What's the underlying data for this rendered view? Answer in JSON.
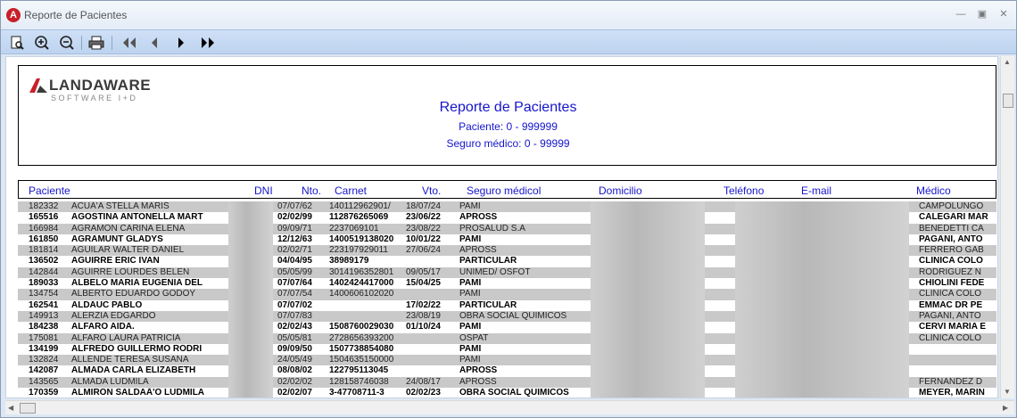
{
  "window": {
    "title": "Reporte de Pacientes"
  },
  "toolbar": {
    "buttons": [
      "preview-icon",
      "zoom-in-icon",
      "zoom-out-icon",
      "print-icon",
      "first-page-icon",
      "prev-page-icon",
      "next-page-icon",
      "last-page-icon"
    ]
  },
  "report": {
    "logo_name": "LANDAWARE",
    "logo_sub": "SOFTWARE I+D",
    "title": "Reporte de Pacientes",
    "subtitle_patient": "Paciente: 0 - 999999",
    "subtitle_insurance": "Seguro médico: 0 - 99999",
    "columns": {
      "paciente": "Paciente",
      "dni": "DNI",
      "nto": "Nto.",
      "carnet": "Carnet",
      "vto": "Vto.",
      "seguro": "Seguro médicol",
      "domicilio": "Domicilio",
      "telefono": "Teléfono",
      "email": "E-mail",
      "medico": "Médico"
    },
    "rows": [
      {
        "id": "182332",
        "name": "ACUÃ'A STELLA MARIS",
        "nto": "07/07/62",
        "carnet": "140112962901/",
        "vto": "18/07/24",
        "seguro": "PAMI",
        "medico": "CAMPOLUNGO"
      },
      {
        "id": "165516",
        "name": "AGOSTINA ANTONELLA MART",
        "nto": "02/02/99",
        "carnet": "112876265069",
        "vto": "23/06/22",
        "seguro": "APROSS",
        "medico": "CALEGARI MAR"
      },
      {
        "id": "166984",
        "name": "AGRAMON CARINA ELENA",
        "nto": "09/09/71",
        "carnet": "2237069101",
        "vto": "23/08/22",
        "seguro": "PROSALUD S.A",
        "medico": "BENEDETTI CA"
      },
      {
        "id": "161850",
        "name": "AGRAMUNT GLADYS",
        "nto": "12/12/63",
        "carnet": "1400519138020",
        "vto": "10/01/22",
        "seguro": "PAMI",
        "medico": "PAGANI, ANTO"
      },
      {
        "id": "181814",
        "name": "AGUILAR WALTER DANIEL",
        "nto": "02/02/71",
        "carnet": "223197929011",
        "vto": "27/06/24",
        "seguro": "APROSS",
        "medico": "FERRERO GAB"
      },
      {
        "id": "136502",
        "name": "AGUIRRE ERIC IVAN",
        "nto": "04/04/95",
        "carnet": "38989179",
        "vto": "",
        "seguro": "PARTICULAR",
        "medico": "CLINICA COLO"
      },
      {
        "id": "142844",
        "name": "AGUIRRE LOURDES BELEN",
        "nto": "05/05/99",
        "carnet": "3014196352801",
        "vto": "09/05/17",
        "seguro": "UNIMED/ OSFOT",
        "medico": "RODRIGUEZ N"
      },
      {
        "id": "189033",
        "name": "ALBELO MARIA EUGENIA DEL",
        "nto": "07/07/64",
        "carnet": "1402424417000",
        "vto": "15/04/25",
        "seguro": "PAMI",
        "medico": "CHIOLINI FEDE"
      },
      {
        "id": "134754",
        "name": "ALBERTO EDUARDO GODOY",
        "nto": "07/07/54",
        "carnet": "1400606102020",
        "vto": "",
        "seguro": "PAMI",
        "medico": "CLINICA COLO"
      },
      {
        "id": "162541",
        "name": "ALDAUC PABLO",
        "nto": "07/07/02",
        "carnet": "",
        "vto": "17/02/22",
        "seguro": "PARTICULAR",
        "medico": "EMMAC DR PE"
      },
      {
        "id": "149913",
        "name": "ALERZIA EDGARDO",
        "nto": "07/07/83",
        "carnet": "",
        "vto": "23/08/19",
        "seguro": "OBRA SOCIAL QUIMICOS",
        "medico": "PAGANI, ANTO"
      },
      {
        "id": "184238",
        "name": "ALFARO AIDA.",
        "nto": "02/02/43",
        "carnet": "1508760029030",
        "vto": "01/10/24",
        "seguro": "PAMI",
        "medico": "CERVI MARIA E"
      },
      {
        "id": "175081",
        "name": "ALFARO LAURA PATRICIA",
        "nto": "05/05/81",
        "carnet": "2728656393200",
        "vto": "",
        "seguro": "OSPAT",
        "medico": "CLINICA COLO"
      },
      {
        "id": "134199",
        "name": "ALFREDO GUILLERMO RODRI",
        "nto": "09/09/50",
        "carnet": "1507738854080",
        "vto": "",
        "seguro": "PAMI",
        "medico": ""
      },
      {
        "id": "132824",
        "name": "ALLENDE TERESA SUSANA",
        "nto": "24/05/49",
        "carnet": "1504635150000",
        "vto": "",
        "seguro": "PAMI",
        "medico": ""
      },
      {
        "id": "142087",
        "name": "ALMADA CARLA ELIZABETH",
        "nto": "08/08/02",
        "carnet": "122795113045",
        "vto": "",
        "seguro": "APROSS",
        "medico": ""
      },
      {
        "id": "143565",
        "name": "ALMADA LUDMILA",
        "nto": "02/02/02",
        "carnet": "128158746038",
        "vto": "24/08/17",
        "seguro": "APROSS",
        "medico": "FERNANDEZ D"
      },
      {
        "id": "170359",
        "name": "ALMIRON SALDAÃ'O LUDMILA",
        "nto": "02/02/07",
        "carnet": "3-47708711-3",
        "vto": "02/02/23",
        "seguro": "OBRA SOCIAL QUIMICOS",
        "medico": "MEYER, MARIN"
      }
    ]
  }
}
